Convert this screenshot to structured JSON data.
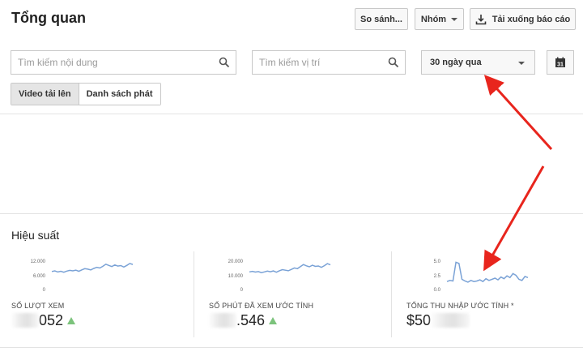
{
  "header": {
    "title": "Tổng quan",
    "compare_label": "So sánh...",
    "group_label": "Nhóm",
    "download_label": "Tải xuống báo cáo"
  },
  "filters": {
    "content_search_placeholder": "Tìm kiếm nội dung",
    "location_search_placeholder": "Tìm kiếm vị trí",
    "date_range": "30 ngày qua",
    "calendar_day": "31"
  },
  "tabs": [
    {
      "label": "Video tải lên",
      "active": true
    },
    {
      "label": "Danh sách phát",
      "active": false
    }
  ],
  "performance": {
    "title": "Hiệu suất",
    "metrics": [
      {
        "label": "SỐ LƯỢT XEM",
        "value_visible": "052",
        "trend": "up",
        "y_ticks": [
          "12.000",
          "6.000",
          "0"
        ],
        "ymax": 12000,
        "series": [
          7600,
          7900,
          7400,
          7700,
          7300,
          7800,
          8100,
          7900,
          8200,
          7700,
          8300,
          8800,
          8600,
          8300,
          8900,
          9400,
          9100,
          9800,
          10700,
          10200,
          9700,
          10400,
          9900,
          10100,
          9500,
          10200,
          11000,
          10600
        ]
      },
      {
        "label": "SỐ PHÚT ĐÃ XEM ƯỚC TÍNH",
        "value_visible": ".546",
        "trend": "up",
        "y_ticks": [
          "20.000",
          "10.000",
          "0"
        ],
        "ymax": 20000,
        "series": [
          12400,
          12800,
          12300,
          12600,
          11900,
          12400,
          13000,
          12500,
          13100,
          12200,
          13200,
          14000,
          13600,
          13200,
          14200,
          15200,
          14700,
          16100,
          17600,
          16700,
          16000,
          17100,
          16300,
          16600,
          15600,
          16800,
          18200,
          17400
        ]
      },
      {
        "label": "TỔNG THU NHẬP ƯỚC TÍNH *",
        "value_visible": "$50",
        "trend": "none",
        "y_ticks": [
          "5.0",
          "2.5",
          "0.0"
        ],
        "ymax": 5.0,
        "series": [
          1.4,
          1.6,
          1.5,
          4.8,
          4.6,
          1.8,
          1.5,
          1.3,
          1.6,
          1.4,
          1.5,
          1.7,
          1.4,
          1.9,
          1.6,
          1.8,
          2.0,
          1.7,
          2.2,
          1.9,
          2.4,
          2.1,
          2.8,
          2.5,
          1.8,
          1.6,
          2.3,
          2.1
        ]
      }
    ]
  },
  "colors": {
    "spark_line": "#7aa2d6",
    "trend_up": "#7cc37c",
    "annotation_arrow": "#e8251d"
  }
}
